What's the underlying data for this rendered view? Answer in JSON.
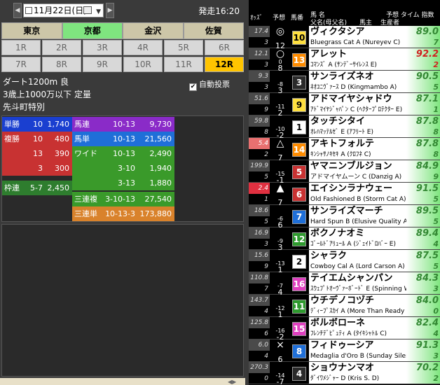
{
  "topbar": {
    "date": "11月22日(日)",
    "start_time": "発走16:20"
  },
  "venues": [
    {
      "label": "東京",
      "active": false
    },
    {
      "label": "京都",
      "active": true
    },
    {
      "label": "金沢",
      "active": false
    },
    {
      "label": "佐賀",
      "active": false
    }
  ],
  "races": [
    "1R",
    "2R",
    "3R",
    "4R",
    "5R",
    "6R",
    "7R",
    "8R",
    "9R",
    "10R",
    "11R",
    "12R"
  ],
  "active_race": "12R",
  "race_info": {
    "line1": "ダート1200m 良",
    "line2": "3歳上1000万以下 定量",
    "line3": "先斗町特別"
  },
  "autovote": {
    "label": "自動投票",
    "checked": true
  },
  "payouts": [
    {
      "type": "単勝",
      "combo": "10",
      "amount": "1,740"
    },
    {
      "type": "複勝",
      "combo": "10",
      "amount": "480"
    },
    {
      "type": "",
      "combo": "13",
      "amount": "390"
    },
    {
      "type": "",
      "combo": "3",
      "amount": "300"
    },
    {
      "type": "枠連",
      "combo": "5-7",
      "amount": "2,450"
    },
    {
      "type": "馬連",
      "combo": "10-13",
      "amount": "9,730"
    },
    {
      "type": "馬単",
      "combo": "10-13",
      "amount": "21,560"
    },
    {
      "type": "ワイド",
      "combo": "10-13",
      "amount": "2,490"
    },
    {
      "type": "",
      "combo": "3-10",
      "amount": "1,940"
    },
    {
      "type": "",
      "combo": "3-13",
      "amount": "1,880"
    },
    {
      "type": "三連複",
      "combo": "3-10-13",
      "amount": "27,540"
    },
    {
      "type": "三連単",
      "combo": "10-13-3",
      "amount": "173,880"
    }
  ],
  "colors": {
    "win": "#1a3fd0",
    "place": "#c83232",
    "bracket": "#2e7d2e",
    "quinella": "#8a2bc8",
    "exacta": "#1f6fd8",
    "wide": "#ff7f00",
    "trio": "#3a9a2a",
    "trifecta": "#d9822b"
  },
  "right_header": {
    "odds": "ｵｯｽﾞ",
    "pred": "予想",
    "num": "馬番",
    "name": "馬 名",
    "parents": "父名(母父名)",
    "owner": "馬主",
    "breeder": "生産者",
    "pred_time": "予想 タイム 指数"
  },
  "horses": [
    {
      "odds": "17.4",
      "pop": "3",
      "mark": "◎",
      "diff": "",
      "pnum": "12",
      "num": "10",
      "name": "ヴィクタシア",
      "sire": "Bluegrass Cat A (Nureyev C)",
      "score": "89.0",
      "sub": "7",
      "top": false,
      "numcolor": "#ffe040",
      "numtext": "#000",
      "oddsclass": ""
    },
    {
      "odds": "12.1",
      "pop": "3",
      "mark": "○",
      "diff": "0",
      "pnum": "8",
      "num": "13",
      "name": "アレット",
      "sire": "ｺﾏﾝｽﾞ A (ｻﾝﾃﾞｰｻｲﾚﾝｽ E)",
      "score": "92.2",
      "sub": "2",
      "top": true,
      "numcolor": "#ff8c00",
      "numtext": "#fff",
      "oddsclass": ""
    },
    {
      "odds": "9.3",
      "pop": "3",
      "mark": "",
      "diff": "-8",
      "pnum": "3",
      "num": "3",
      "name": "サンライズネオ",
      "sire": "ﾈｵﾕﾆｳﾞｧｰｽ D (Kingmambo A)",
      "score": "90.5",
      "sub": "5",
      "top": false,
      "numcolor": "#2a2a2a",
      "numtext": "#fff",
      "oddsclass": ""
    },
    {
      "odds": "51.6",
      "pop": "9",
      "mark": "",
      "diff": "-11",
      "pnum": "2",
      "num": "9",
      "name": "アドマイヤシャドウ",
      "sire": "ｱﾄﾞﾏｲﾔｼﾞｬﾊﾟﾝ C (ﾍｸﾀｰﾌﾟﾛﾃｸﾀｰ E)",
      "score": "87.1",
      "sub": "1",
      "top": false,
      "numcolor": "#ffe040",
      "numtext": "#000",
      "oddsclass": ""
    },
    {
      "odds": "59.8",
      "pop": "8",
      "mark": "",
      "diff": "-10",
      "pnum": "-2",
      "num": "1",
      "name": "タッチシタイ",
      "sire": "ｵﾚﾊﾏｯﾃﾙｾﾞ E (ｱﾌﾘｰﾄ E)",
      "score": "87.8",
      "sub": "8",
      "top": false,
      "numcolor": "#ffffff",
      "numtext": "#000",
      "oddsclass": ""
    },
    {
      "odds": "5.4",
      "pop": "2",
      "mark": "△",
      "diff": "",
      "pnum": "7",
      "num": "14",
      "name": "アキトフォルテ",
      "sire": "ｷﾝｼｬｻﾉｷｾｷ A (ｸﾛﾌﾈ C)",
      "score": "87.8",
      "sub": "8",
      "top": false,
      "numcolor": "#ff8c00",
      "numtext": "#fff",
      "oddsclass": "fav2"
    },
    {
      "odds": "199.9",
      "pop": "5",
      "mark": "",
      "diff": "-15",
      "pnum": "-1",
      "num": "5",
      "name": "ヤマニンブルジョン",
      "sire": "アドマイヤムーン C (Danzig A)",
      "score": "84.9",
      "sub": "9",
      "top": false,
      "numcolor": "#c83232",
      "numtext": "#fff",
      "oddsclass": ""
    },
    {
      "odds": "2.4",
      "pop": "1",
      "mark": "▲",
      "diff": "",
      "pnum": "7",
      "num": "6",
      "name": "エイシンラナウェー",
      "sire": "Old Fashioned B (Storm Cat A)",
      "score": "91.5",
      "sub": "5",
      "top": false,
      "numcolor": "#c83232",
      "numtext": "#fff",
      "oddsclass": "fav1"
    },
    {
      "odds": "18.6",
      "pop": "5",
      "mark": "",
      "diff": "-6",
      "pnum": "6",
      "num": "7",
      "name": "サンライズマーチ",
      "sire": "Hard Spun B (Elusive Quality A)",
      "score": "89.5",
      "sub": "5",
      "top": false,
      "numcolor": "#1f6fd8",
      "numtext": "#fff",
      "oddsclass": ""
    },
    {
      "odds": "16.9",
      "pop": "3",
      "mark": "",
      "diff": "-9",
      "pnum": "3",
      "num": "12",
      "name": "ボクノナオミ",
      "sire": "ｺﾞｰﾙﾄﾞｱﾘｭｰﾙ A (ｼﾞｪｲﾄﾞﾛﾊﾞｰ E)",
      "score": "89.4",
      "sub": "4",
      "top": false,
      "numcolor": "#2e9a2e",
      "numtext": "#fff",
      "oddsclass": ""
    },
    {
      "odds": "15.6",
      "pop": "9",
      "mark": "",
      "diff": "-13",
      "pnum": "1",
      "num": "2",
      "name": "シャラク",
      "sire": "Cowboy Cal A (Lord Carson A)",
      "score": "87.5",
      "sub": "5",
      "top": false,
      "numcolor": "#ffffff",
      "numtext": "#000",
      "oddsclass": ""
    },
    {
      "odds": "110.8",
      "pop": "7",
      "mark": "",
      "diff": "-7",
      "pnum": "4",
      "num": "16",
      "name": "テイエムシャンパン",
      "sire": "ｽｳｪﾌﾟﾄｵｰｳﾞｧｰﾎﾞｰﾄﾞ E (Spinning World)",
      "score": "84.3",
      "sub": "3",
      "top": false,
      "numcolor": "#e040c0",
      "numtext": "#fff",
      "oddsclass": ""
    },
    {
      "odds": "143.7",
      "pop": "4",
      "mark": "",
      "diff": "-12",
      "pnum": "1",
      "num": "11",
      "name": "ウチデノコヅチ",
      "sire": "ﾃﾞｨｰﾌﾟｽｶｲ A (More Than Ready C)",
      "score": "84.0",
      "sub": "0",
      "top": false,
      "numcolor": "#2e9a2e",
      "numtext": "#fff",
      "oddsclass": ""
    },
    {
      "odds": "125.8",
      "pop": "6",
      "mark": "",
      "diff": "-16",
      "pnum": "-2",
      "num": "15",
      "name": "ボルボローネ",
      "sire": "ﾌﾚﾝﾁﾃﾞﾋﾟｭﾃｨ A (ﾀｲｷｼｬﾄﾙ C)",
      "score": "82.4",
      "sub": "4",
      "top": false,
      "numcolor": "#e040c0",
      "numtext": "#fff",
      "oddsclass": ""
    },
    {
      "odds": "6.0",
      "pop": "4",
      "mark": "×",
      "diff": "",
      "pnum": "6",
      "num": "8",
      "name": "フィドゥーシア",
      "sire": "Medaglia d'Oro B (Sunday Silence)",
      "score": "91.3",
      "sub": "3",
      "top": false,
      "numcolor": "#1f6fd8",
      "numtext": "#fff",
      "oddsclass": ""
    },
    {
      "odds": "270.3",
      "pop": "0",
      "mark": "",
      "diff": "-14",
      "pnum": "-7",
      "num": "4",
      "name": "ショウナンマオ",
      "sire": "ﾀﾞｲﾜﾒｼﾞｬｰ D (Kris S. D)",
      "score": "70.2",
      "sub": "2",
      "top": false,
      "numcolor": "#2a2a2a",
      "numtext": "#fff",
      "oddsclass": ""
    }
  ]
}
